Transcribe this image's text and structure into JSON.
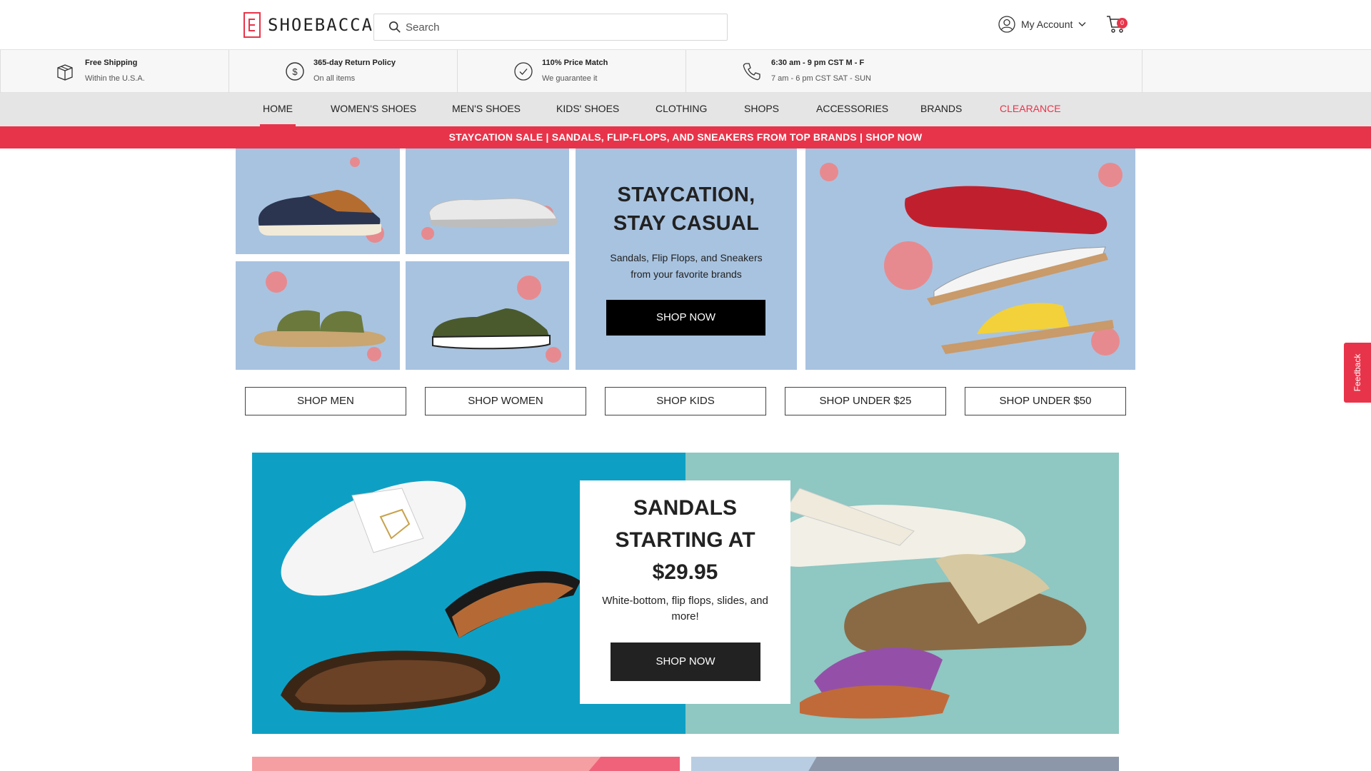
{
  "header": {
    "logo_text": "SHOEBACCA",
    "search_placeholder": "Search",
    "account_label": "My Account",
    "cart_count": "0"
  },
  "benefits": [
    {
      "icon": "box-icon",
      "title": "Free Shipping",
      "subtitle": "Within the U.S.A."
    },
    {
      "icon": "dollar-icon",
      "title": "365-day Return Policy",
      "subtitle": "On all items"
    },
    {
      "icon": "check-icon",
      "title": "110% Price Match",
      "subtitle": "We guarantee it"
    },
    {
      "icon": "phone-icon",
      "title": "6:30 am - 9 pm CST M - F",
      "subtitle": "7 am - 6 pm CST SAT - SUN"
    }
  ],
  "nav": [
    {
      "label": "HOME",
      "active": true
    },
    {
      "label": "WOMEN'S SHOES"
    },
    {
      "label": "MEN'S SHOES"
    },
    {
      "label": "KIDS' SHOES"
    },
    {
      "label": "CLOTHING"
    },
    {
      "label": "SHOPS"
    },
    {
      "label": "ACCESSORIES"
    },
    {
      "label": "BRANDS"
    },
    {
      "label": "CLEARANCE",
      "color": "#e8344a"
    }
  ],
  "promo_strip": "STAYCATION SALE | SANDALS, FLIP-FLOPS, AND SNEAKERS FROM TOP BRANDS | SHOP NOW",
  "hero": {
    "title_line1": "STAYCATION,",
    "title_line2": "STAY CASUAL",
    "subtitle_line1": "Sandals, Flip Flops, and Sneakers",
    "subtitle_line2": "from your favorite brands",
    "button": "SHOP NOW"
  },
  "category_buttons": [
    "SHOP MEN",
    "SHOP WOMEN",
    "SHOP KIDS",
    "SHOP UNDER $25",
    "SHOP UNDER $50"
  ],
  "sandals_banner": {
    "title_line1": "SANDALS",
    "title_line2": "STARTING AT",
    "title_line3": "$29.95",
    "subtitle": "White-bottom, flip flops, slides, and more!",
    "button": "SHOP NOW"
  },
  "feedback_tab": "Feedback",
  "colors": {
    "accent": "#e8344a",
    "hero_blue": "#a8c3e0",
    "sandals_blue": "#0ea0c4",
    "sandals_teal": "#8fc7c2"
  }
}
